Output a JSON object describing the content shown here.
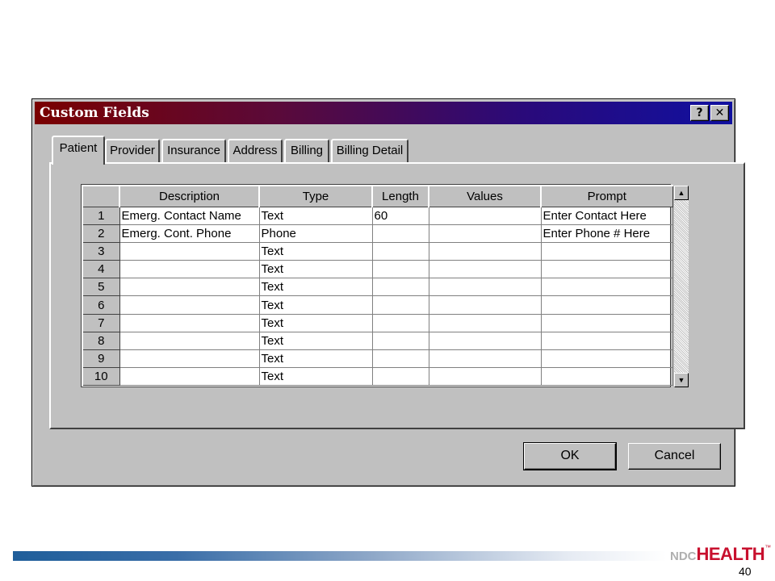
{
  "dialog": {
    "title": "Custom Fields",
    "help_glyph": "?",
    "close_glyph": "✕"
  },
  "tabs": [
    {
      "label": "Patient",
      "active": true
    },
    {
      "label": "Provider",
      "active": false
    },
    {
      "label": "Insurance",
      "active": false
    },
    {
      "label": "Address",
      "active": false
    },
    {
      "label": "Billing",
      "active": false
    },
    {
      "label": "Billing Detail",
      "active": false
    }
  ],
  "grid": {
    "columns": [
      "Description",
      "Type",
      "Length",
      "Values",
      "Prompt"
    ],
    "rows": [
      {
        "num": "1",
        "description": "Emerg. Contact Name",
        "type": "Text",
        "length": "60",
        "values": "",
        "prompt": "Enter Contact Here"
      },
      {
        "num": "2",
        "description": "Emerg. Cont. Phone",
        "type": "Phone",
        "length": "",
        "values": "",
        "prompt": "Enter Phone # Here"
      },
      {
        "num": "3",
        "description": "",
        "type": "Text",
        "length": "",
        "values": "",
        "prompt": ""
      },
      {
        "num": "4",
        "description": "",
        "type": "Text",
        "length": "",
        "values": "",
        "prompt": ""
      },
      {
        "num": "5",
        "description": "",
        "type": "Text",
        "length": "",
        "values": "",
        "prompt": ""
      },
      {
        "num": "6",
        "description": "",
        "type": "Text",
        "length": "",
        "values": "",
        "prompt": ""
      },
      {
        "num": "7",
        "description": "",
        "type": "Text",
        "length": "",
        "values": "",
        "prompt": ""
      },
      {
        "num": "8",
        "description": "",
        "type": "Text",
        "length": "",
        "values": "",
        "prompt": ""
      },
      {
        "num": "9",
        "description": "",
        "type": "Text",
        "length": "",
        "values": "",
        "prompt": ""
      },
      {
        "num": "10",
        "description": "",
        "type": "Text",
        "length": "",
        "values": "",
        "prompt": ""
      }
    ]
  },
  "scrollbar": {
    "up_glyph": "▲",
    "down_glyph": "▼"
  },
  "buttons": {
    "ok": "OK",
    "cancel": "Cancel"
  },
  "footer": {
    "logo_ndc": "NDC",
    "logo_health": "HEALTH",
    "logo_tm": "™",
    "page_number": "40"
  }
}
